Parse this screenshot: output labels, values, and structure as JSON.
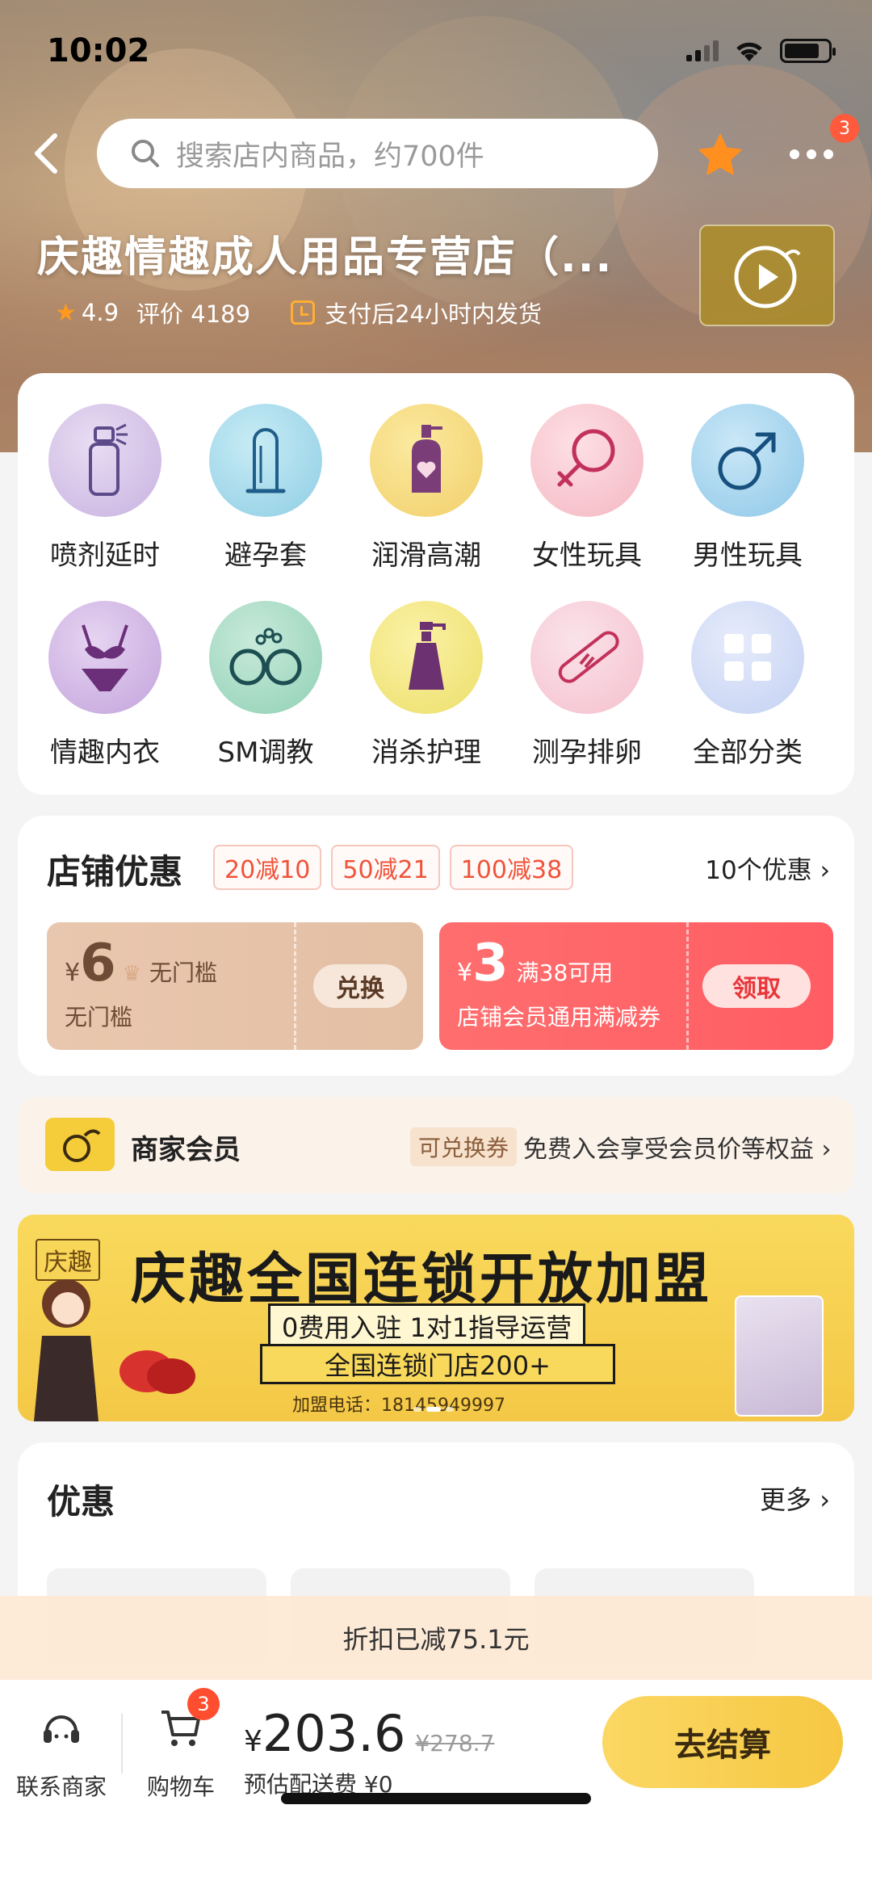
{
  "status_bar": {
    "time": "10:02"
  },
  "header": {
    "search_placeholder": "搜索店内商品，约700件",
    "more_badge": "3",
    "shop_name": "庆趣情趣成人用品专营店（...",
    "rating": "4.9",
    "reviews": "评价 4189",
    "shipping_promise": "支付后24小时内发货"
  },
  "categories": [
    {
      "label": "喷剂延时",
      "icon": "spray-icon"
    },
    {
      "label": "避孕套",
      "icon": "condom-icon"
    },
    {
      "label": "润滑高潮",
      "icon": "lube-bottle-icon"
    },
    {
      "label": "女性玩具",
      "icon": "female-symbol-icon"
    },
    {
      "label": "男性玩具",
      "icon": "male-symbol-icon"
    },
    {
      "label": "情趣内衣",
      "icon": "lingerie-icon"
    },
    {
      "label": "SM调教",
      "icon": "handcuffs-icon"
    },
    {
      "label": "消杀护理",
      "icon": "pump-bottle-icon"
    },
    {
      "label": "测孕排卵",
      "icon": "pregnancy-test-icon"
    },
    {
      "label": "全部分类",
      "icon": "grid-icon"
    }
  ],
  "coupons": {
    "title": "店铺优惠",
    "tags": [
      "20减10",
      "50减21",
      "100减38"
    ],
    "more": "10个优惠",
    "left": {
      "currency": "¥",
      "amount": "6",
      "condition": "无门槛",
      "subtitle": "无门槛",
      "button": "兑换"
    },
    "right": {
      "currency": "¥",
      "amount": "3",
      "condition": "满38可用",
      "subtitle": "店铺会员通用满减券",
      "button": "领取"
    }
  },
  "member": {
    "title": "商家会员",
    "tag": "可兑换券",
    "desc": "免费入会享受会员价等权益"
  },
  "banner": {
    "brand": "庆趣",
    "headline": "庆趣全国连锁开放加盟",
    "sub": "0费用入驻 1对1指导运营",
    "ribbon": "全国连锁门店200+",
    "phone": "加盟电话：18145949997"
  },
  "deals": {
    "title": "优惠",
    "more": "更多"
  },
  "discount_strip": "折扣已减75.1元",
  "bottom_bar": {
    "contact": "联系商家",
    "cart": "购物车",
    "cart_badge": "3",
    "currency": "¥",
    "price": "203.6",
    "original_price": "¥278.7",
    "shipping": "预估配送费 ¥0",
    "checkout": "去结算"
  },
  "colors": {
    "accent": "#f6c742",
    "price_red": "#ff5d63",
    "star": "#ff9a1f"
  }
}
